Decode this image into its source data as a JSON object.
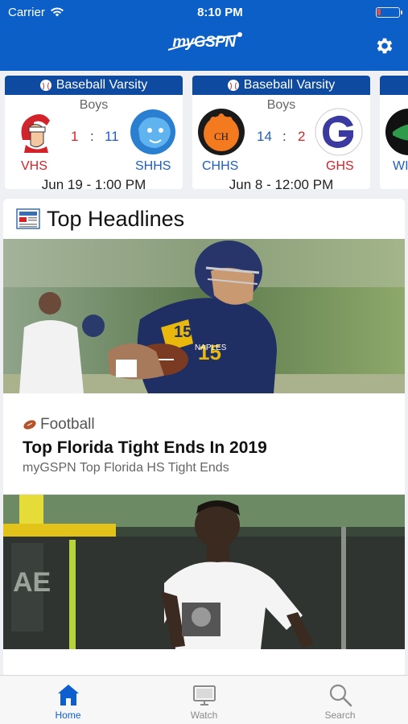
{
  "status_bar": {
    "carrier": "Carrier",
    "time": "8:10 PM"
  },
  "header": {
    "logo": "myGSPN"
  },
  "score_cards": [
    {
      "sport": "Baseball Varsity",
      "gender": "Boys",
      "home_abbr": "VHS",
      "home_score": "1",
      "away_score": "11",
      "away_abbr": "SHHS",
      "date": "Jun 19 - 1:00 PM"
    },
    {
      "sport": "Baseball Varsity",
      "gender": "Boys",
      "home_abbr": "CHHS",
      "home_score": "14",
      "away_score": "2",
      "away_abbr": "GHS",
      "date": "Jun 8 - 12:00 PM"
    },
    {
      "away_abbr": "WI"
    }
  ],
  "headlines": {
    "title": "Top Headlines",
    "articles": [
      {
        "sport": "Football",
        "title": "Top Florida Tight Ends In 2019",
        "subtitle": "myGSPN Top Florida HS Tight Ends"
      }
    ]
  },
  "tabs": [
    {
      "label": "Home",
      "icon": "home-icon",
      "active": true
    },
    {
      "label": "Watch",
      "icon": "tv-icon",
      "active": false
    },
    {
      "label": "Search",
      "icon": "search-icon",
      "active": false
    }
  ],
  "colors": {
    "brand": "#0b5fc6",
    "card_header": "#0d4aa0",
    "score_red": "#d3232a",
    "score_blue": "#1f5fbf",
    "tab_active": "#0d5fd0"
  }
}
